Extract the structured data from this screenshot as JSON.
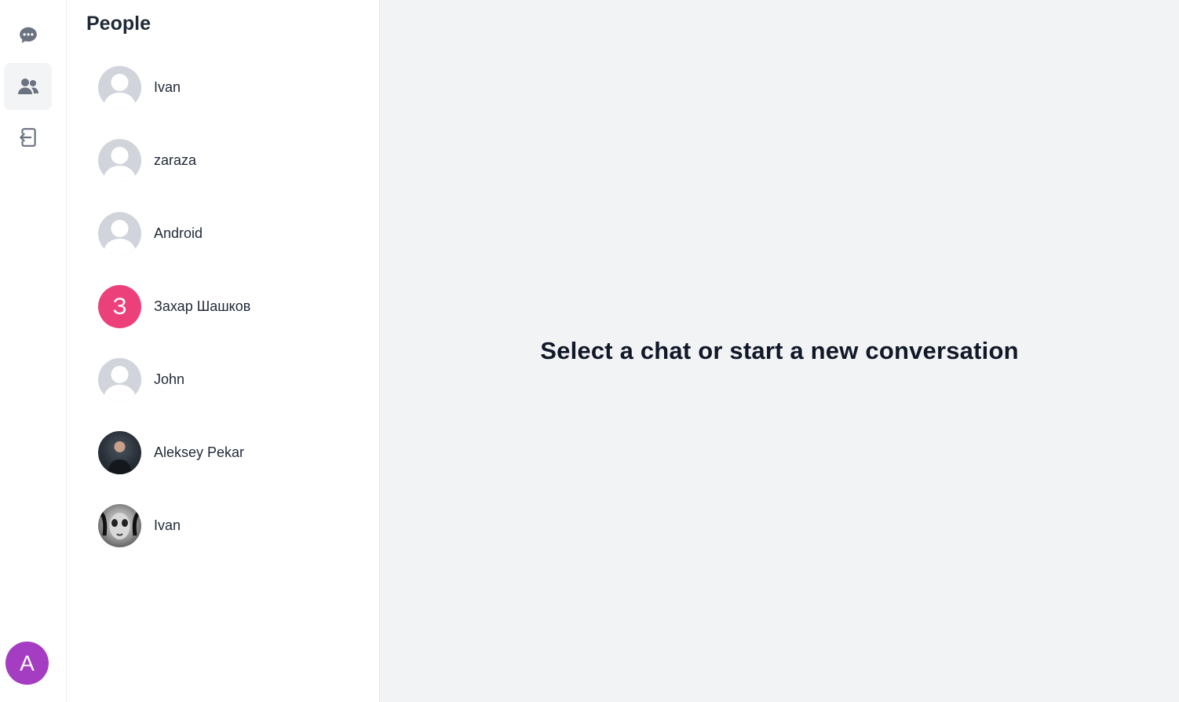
{
  "rail": {
    "items": [
      {
        "icon": "chat-bubble-icon",
        "active": false
      },
      {
        "icon": "people-icon",
        "active": true
      },
      {
        "icon": "logout-icon",
        "active": false
      }
    ],
    "user_avatar_letter": "A",
    "user_avatar_color": "#a43dc2"
  },
  "people": {
    "title": "People",
    "items": [
      {
        "name": "Ivan",
        "avatar": "placeholder"
      },
      {
        "name": "zaraza",
        "avatar": "placeholder"
      },
      {
        "name": "Android",
        "avatar": "placeholder"
      },
      {
        "name": "Захар Шашков",
        "avatar": "letter",
        "letter": "З",
        "color": "#ec407a"
      },
      {
        "name": "John",
        "avatar": "placeholder"
      },
      {
        "name": "Aleksey Pekar",
        "avatar": "photo"
      },
      {
        "name": "Ivan",
        "avatar": "photo"
      }
    ]
  },
  "main": {
    "empty_message": "Select a chat or start a new conversation"
  },
  "colors": {
    "icon": "#6b7280",
    "active_bg": "#f3f4f6",
    "main_bg": "#f2f3f5",
    "placeholder_avatar": "#d1d5db"
  }
}
